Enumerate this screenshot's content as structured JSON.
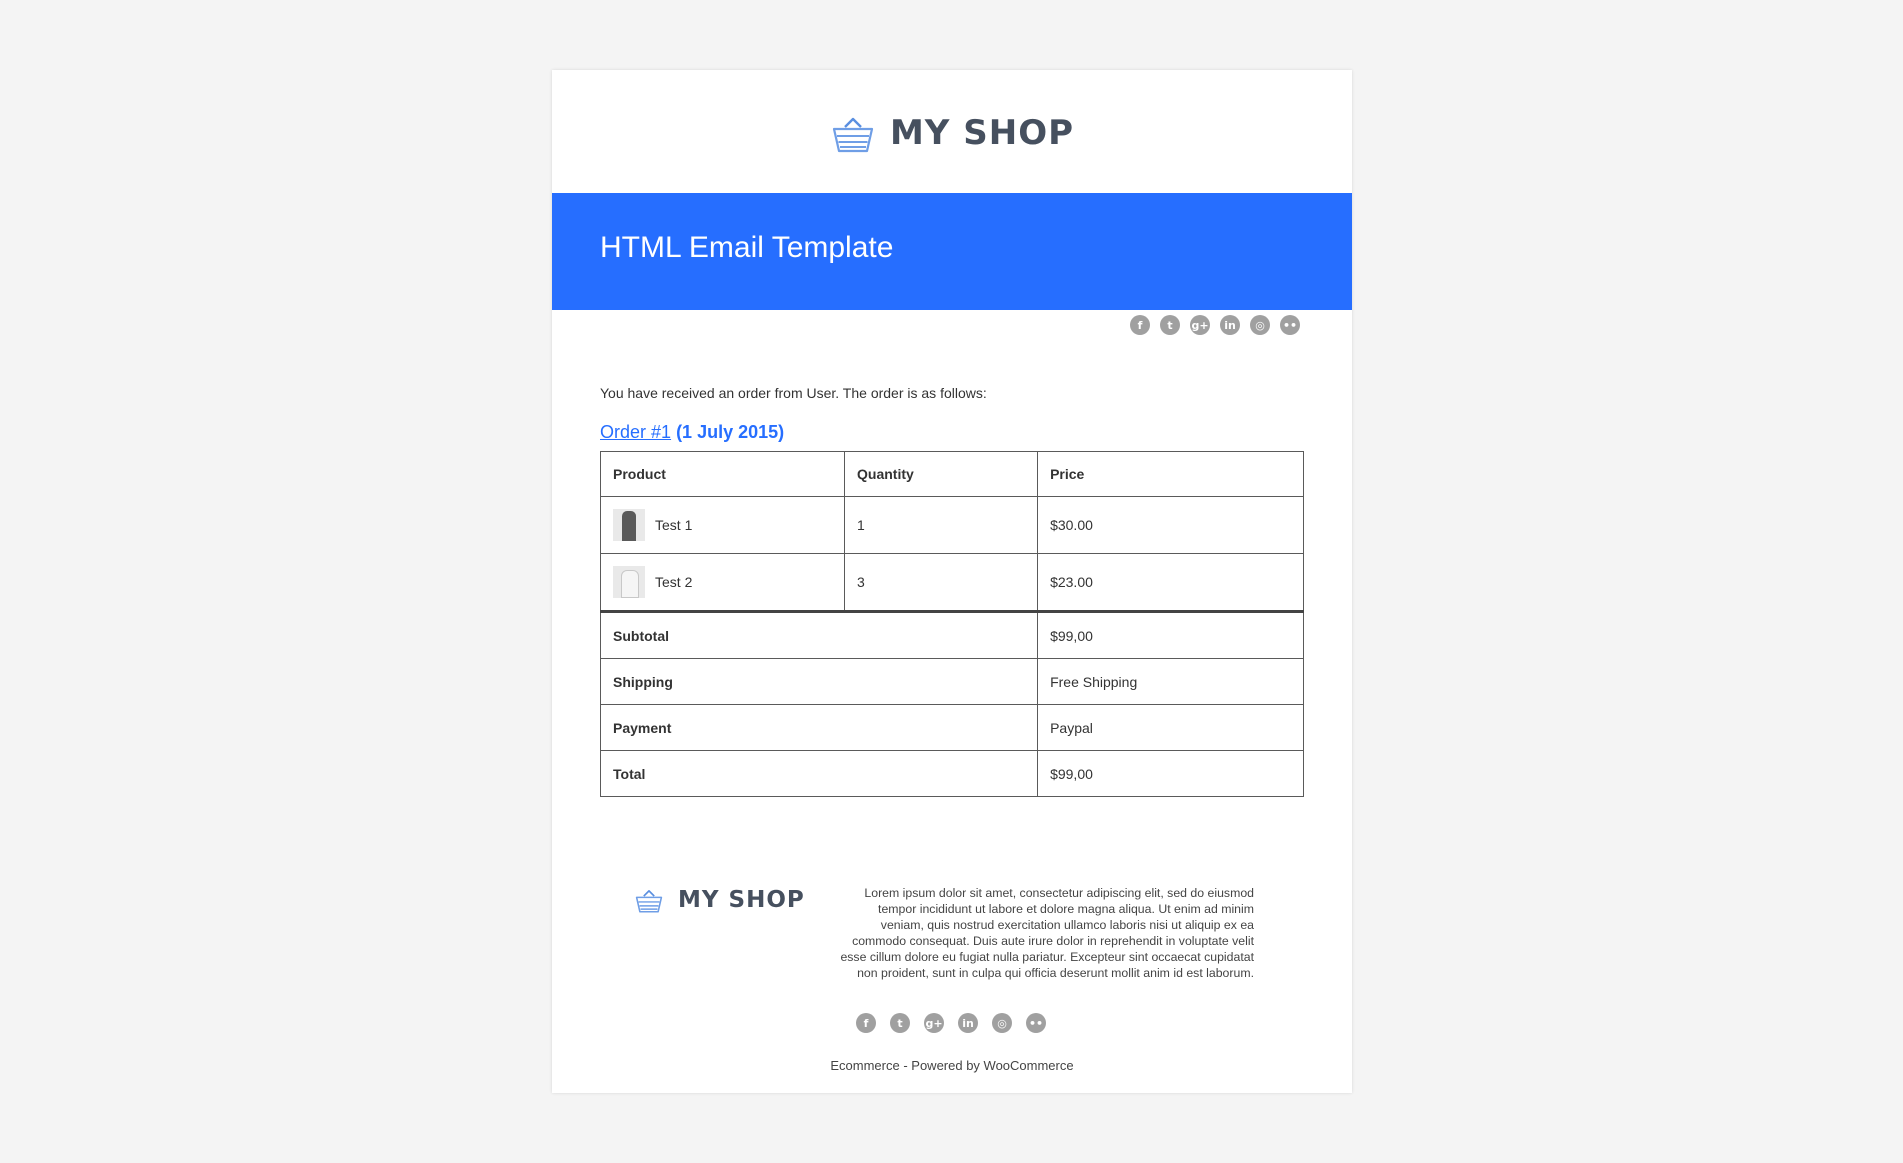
{
  "brand": {
    "name": "MY SHOP",
    "accent_color": "#266eff",
    "logo_icon": "basket-icon"
  },
  "banner": {
    "title": "HTML Email Template"
  },
  "social": [
    {
      "name": "facebook-icon",
      "glyph": "f"
    },
    {
      "name": "twitter-icon",
      "glyph": "t"
    },
    {
      "name": "google-plus-icon",
      "glyph": "g+"
    },
    {
      "name": "linkedin-icon",
      "glyph": "in"
    },
    {
      "name": "instagram-icon",
      "glyph": "◎"
    },
    {
      "name": "flickr-icon",
      "glyph": "••"
    }
  ],
  "intro": "You have received an order from User. The order is as follows:",
  "order": {
    "link_text": "Order #1",
    "date": "(1 July 2015)",
    "columns": [
      "Product",
      "Quantity",
      "Price"
    ],
    "items": [
      {
        "name": "Test 1",
        "qty": "1",
        "price": "$30.00",
        "thumb": "coat-thumbnail"
      },
      {
        "name": "Test 2",
        "qty": "3",
        "price": "$23.00",
        "thumb": "shirt-thumbnail"
      }
    ],
    "totals": [
      {
        "label": "Subtotal",
        "value": "$99,00"
      },
      {
        "label": "Shipping",
        "value": "Free Shipping"
      },
      {
        "label": "Payment",
        "value": "Paypal"
      },
      {
        "label": "Total",
        "value": "$99,00"
      }
    ]
  },
  "footer": {
    "text": "Lorem ipsum dolor sit amet, consectetur adipiscing elit, sed do eiusmod tempor incididunt ut labore et dolore magna aliqua. Ut enim ad minim veniam, quis nostrud exercitation ullamco laboris nisi ut aliquip ex ea commodo consequat. Duis aute irure dolor in reprehendit in voluptate velit esse cillum dolore eu fugiat nulla pariatur. Excepteur sint occaecat cupidatat non proident, sunt in culpa qui officia deserunt mollit anim id est laborum.",
    "powered": "Ecommerce - Powered by WooCommerce"
  }
}
